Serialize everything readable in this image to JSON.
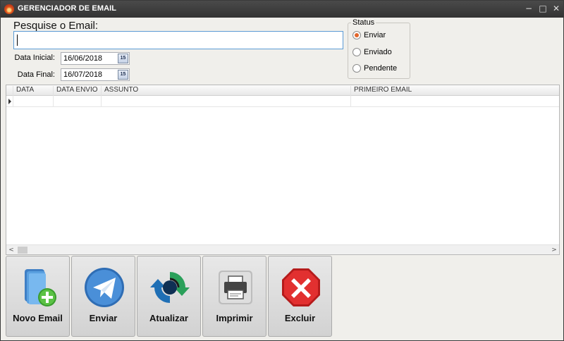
{
  "window": {
    "title": "GERENCIADOR DE EMAIL"
  },
  "search": {
    "label": "Pesquise o Email:",
    "value": ""
  },
  "filters": {
    "start_label": "Data Inicial:",
    "start_value": "16/06/2018",
    "end_label": "Data Final:",
    "end_value": "16/07/2018"
  },
  "status": {
    "legend": "Status",
    "options": [
      {
        "label": "Enviar",
        "selected": true
      },
      {
        "label": "Enviado",
        "selected": false
      },
      {
        "label": "Pendente",
        "selected": false
      }
    ]
  },
  "grid": {
    "columns": [
      "DATA",
      "DATA ENVIO",
      "ASSUNTO",
      "PRIMEIRO EMAIL"
    ],
    "rows": []
  },
  "toolbar": {
    "buttons": [
      {
        "label": "Novo Email",
        "icon": "new-email-icon"
      },
      {
        "label": "Enviar",
        "icon": "send-icon"
      },
      {
        "label": "Atualizar",
        "icon": "refresh-icon"
      },
      {
        "label": "Imprimir",
        "icon": "printer-icon"
      },
      {
        "label": "Excluir",
        "icon": "delete-icon"
      }
    ]
  }
}
